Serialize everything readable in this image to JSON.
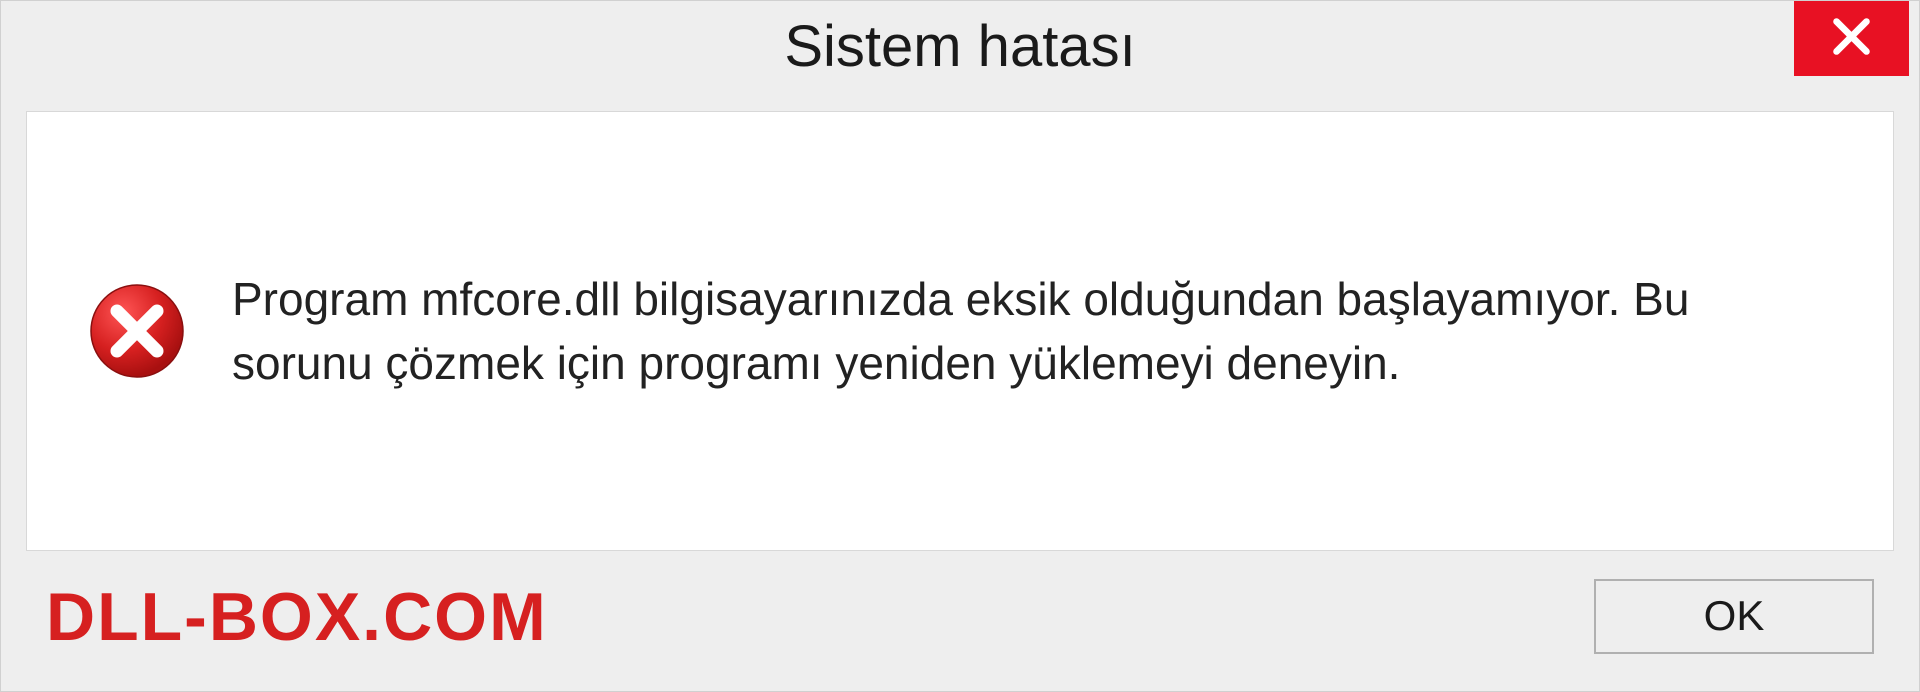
{
  "dialog": {
    "title": "Sistem hatası",
    "message": "Program mfcore.dll bilgisayarınızda eksik olduğundan başlayamıyor. Bu sorunu çözmek için programı yeniden yüklemeyi deneyin.",
    "ok_label": "OK"
  },
  "watermark": "DLL-BOX.COM",
  "colors": {
    "close_bg": "#e81123",
    "error_icon": "#d62020",
    "watermark": "#d62020"
  }
}
